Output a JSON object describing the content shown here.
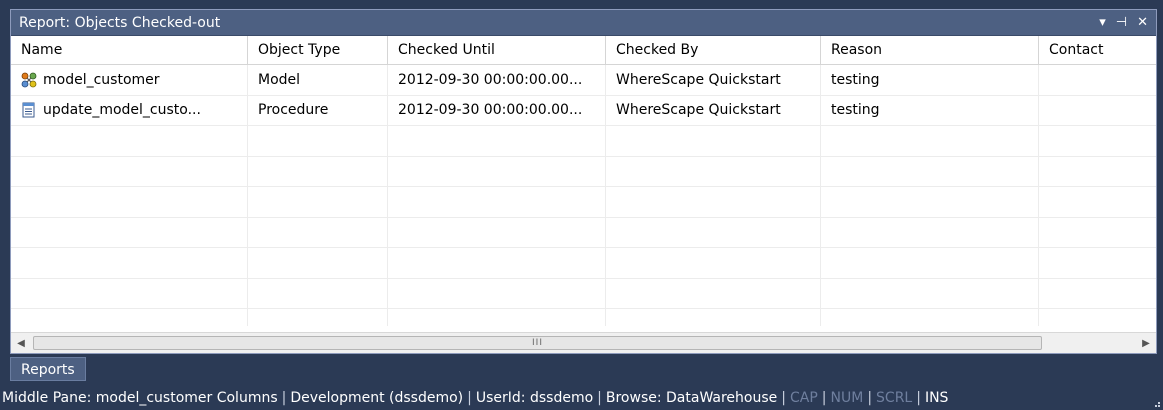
{
  "window": {
    "title": "Report: Objects Checked-out",
    "controls": {
      "dropdown": "▾",
      "pin": "⊣",
      "close": "✕"
    }
  },
  "table": {
    "columns": [
      "Name",
      "Object Type",
      "Checked Until",
      "Checked By",
      "Reason",
      "Contact"
    ],
    "rows": [
      {
        "icon": "model-icon",
        "name": "model_customer",
        "type": "Model",
        "until": "2012-09-30 00:00:00.00...",
        "by": "WhereScape Quickstart",
        "reason": "testing",
        "contact": ""
      },
      {
        "icon": "procedure-icon",
        "name": "update_model_custo...",
        "type": "Procedure",
        "until": "2012-09-30 00:00:00.00...",
        "by": "WhereScape Quickstart",
        "reason": "testing",
        "contact": ""
      }
    ]
  },
  "scrollbar": {
    "thumb_label": "III"
  },
  "tabs": {
    "reports": "Reports"
  },
  "status": {
    "middle_pane": "Middle Pane: model_customer Columns",
    "environment": "Development (dssdemo)",
    "userid": "UserId: dssdemo",
    "browse": "Browse: DataWarehouse",
    "cap": "CAP",
    "num": "NUM",
    "scrl": "SCRL",
    "ins": "INS"
  }
}
